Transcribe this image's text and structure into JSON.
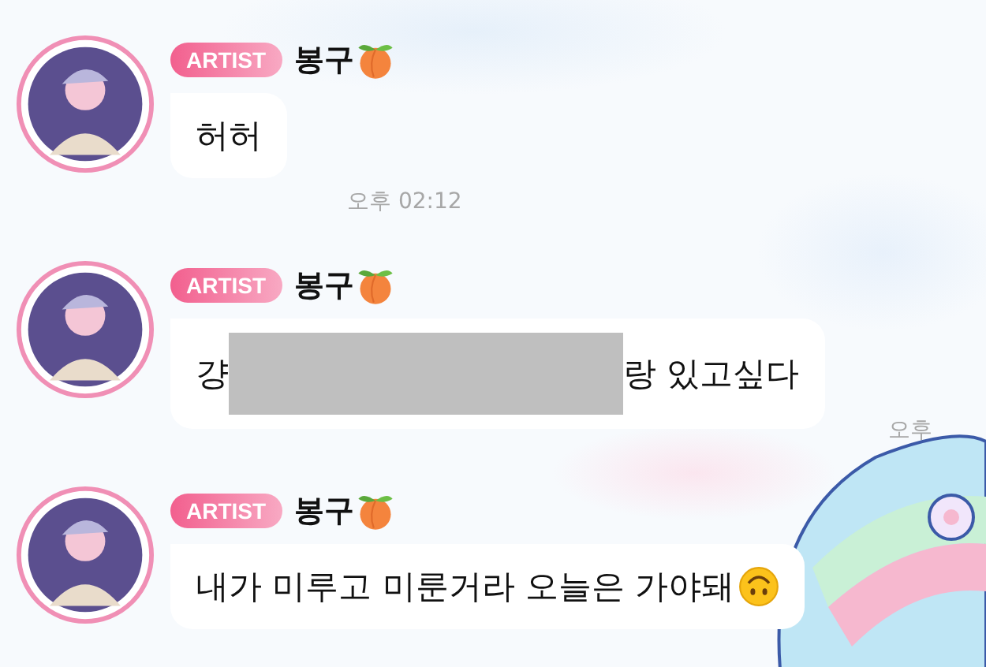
{
  "messages": [
    {
      "badge": "ARTIST",
      "sender": "봉구",
      "parts": [
        {
          "kind": "text",
          "text": "허허"
        }
      ],
      "time": "오후 02:12"
    },
    {
      "badge": "ARTIST",
      "sender": "봉구",
      "parts": [
        {
          "kind": "text",
          "text": "걍"
        },
        {
          "kind": "redacted"
        },
        {
          "kind": "text",
          "text": "랑 있고싶다"
        }
      ],
      "time": "오후"
    },
    {
      "badge": "ARTIST",
      "sender": "봉구",
      "parts": [
        {
          "kind": "text",
          "text": "내가 미루고 미룬거라 오늘은 가야돼"
        },
        {
          "kind": "emoji"
        }
      ]
    }
  ]
}
